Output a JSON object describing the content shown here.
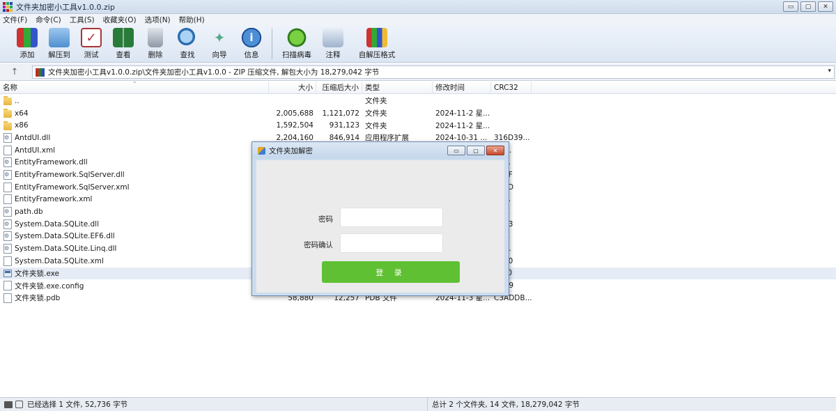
{
  "window": {
    "title": "文件夹加密小工具v1.0.0.zip",
    "minimize": "▭",
    "maximize": "▢",
    "close": "✕"
  },
  "menu": [
    "文件(F)",
    "命令(C)",
    "工具(S)",
    "收藏夹(O)",
    "选项(N)",
    "帮助(H)"
  ],
  "toolbar": [
    {
      "label": "添加",
      "icon": "add-archive-icon"
    },
    {
      "label": "解压到",
      "icon": "extract-folder-icon"
    },
    {
      "label": "测试",
      "icon": "test-checklist-icon"
    },
    {
      "label": "查看",
      "icon": "view-book-icon"
    },
    {
      "label": "删除",
      "icon": "trash-icon"
    },
    {
      "label": "查找",
      "icon": "magnifier-icon"
    },
    {
      "label": "向导",
      "icon": "wizard-wand-icon"
    },
    {
      "label": "信息",
      "icon": "info-icon"
    },
    {
      "label": "扫描病毒",
      "icon": "virus-scan-icon"
    },
    {
      "label": "注释",
      "icon": "comment-icon"
    },
    {
      "label": "自解压格式",
      "icon": "sfx-archive-icon"
    }
  ],
  "address": {
    "up": "↑",
    "path": "文件夹加密小工具v1.0.0.zip\\文件夹加密小工具v1.0.0 - ZIP 压缩文件, 解包大小为 18,279,042 字节",
    "dropdown": "▾"
  },
  "columns": {
    "name": "名称",
    "size": "大小",
    "packed": "压缩后大小",
    "type": "类型",
    "modified": "修改时间",
    "crc": "CRC32"
  },
  "files": [
    {
      "name": "..",
      "size": "",
      "packed": "",
      "type": "文件夹",
      "modified": "",
      "crc": "",
      "icon": "folder"
    },
    {
      "name": "x64",
      "size": "2,005,688",
      "packed": "1,121,072",
      "type": "文件夹",
      "modified": "2024-11-2 星...",
      "crc": "",
      "icon": "folder"
    },
    {
      "name": "x86",
      "size": "1,592,504",
      "packed": "931,123",
      "type": "文件夹",
      "modified": "2024-11-2 星...",
      "crc": "",
      "icon": "folder"
    },
    {
      "name": "AntdUI.dll",
      "size": "2,204,160",
      "packed": "846,914",
      "type": "应用程序扩展",
      "modified": "2024-10-31 ...",
      "crc": "316D39...",
      "icon": "dll"
    },
    {
      "name": "AntdUI.xml",
      "size": "",
      "packed": "",
      "type": "",
      "modified": "",
      "crc": "AD...",
      "icon": "doc"
    },
    {
      "name": "EntityFramework.dll",
      "size": "",
      "packed": "",
      "type": "",
      "modified": "",
      "crc": "B7...",
      "icon": "dll"
    },
    {
      "name": "EntityFramework.SqlServer.dll",
      "size": "",
      "packed": "",
      "type": "",
      "modified": "",
      "crc": "5B9F",
      "icon": "dll"
    },
    {
      "name": "EntityFramework.SqlServer.xml",
      "size": "",
      "packed": "",
      "type": "",
      "modified": "",
      "crc": "655D",
      "icon": "doc"
    },
    {
      "name": "EntityFramework.xml",
      "size": "",
      "packed": "",
      "type": "",
      "modified": "",
      "crc": "C7...",
      "icon": "doc"
    },
    {
      "name": "path.db",
      "size": "",
      "packed": "",
      "type": "",
      "modified": "",
      "crc": "79...",
      "icon": "dll"
    },
    {
      "name": "System.Data.SQLite.dll",
      "size": "",
      "packed": "",
      "type": "",
      "modified": "",
      "crc": "46C3",
      "icon": "dll"
    },
    {
      "name": "System.Data.SQLite.EF6.dll",
      "size": "",
      "packed": "",
      "type": "",
      "modified": "",
      "crc": "62...",
      "icon": "dll"
    },
    {
      "name": "System.Data.SQLite.Linq.dll",
      "size": "",
      "packed": "",
      "type": "",
      "modified": "",
      "crc": "D1...",
      "icon": "dll"
    },
    {
      "name": "System.Data.SQLite.xml",
      "size": "",
      "packed": "",
      "type": "",
      "modified": "",
      "crc": "B440",
      "icon": "doc"
    },
    {
      "name": "文件夹锁.exe",
      "size": "",
      "packed": "",
      "type": "",
      "modified": "",
      "crc": "F440",
      "icon": "exe",
      "selected": true
    },
    {
      "name": "文件夹锁.exe.config",
      "size": "",
      "packed": "",
      "type": "",
      "modified": "",
      "crc": "D1E9",
      "icon": "doc"
    },
    {
      "name": "文件夹锁.pdb",
      "size": "58,880",
      "packed": "12,257",
      "type": "PDB 文件",
      "modified": "2024-11-3 星...",
      "crc": "C3ADDB...",
      "icon": "doc"
    }
  ],
  "dialog": {
    "title": "文件夹加解密",
    "minimize": "▭",
    "maximize": "▢",
    "close": "✕",
    "password_label": "密码",
    "password_value": "",
    "confirm_label": "密码确认",
    "confirm_value": "",
    "login_button": "登 录",
    "accent": "#5fc033"
  },
  "status": {
    "left": "已经选择 1 文件, 52,736 字节",
    "right": "总计 2 个文件夹, 14 文件, 18,279,042 字节"
  }
}
